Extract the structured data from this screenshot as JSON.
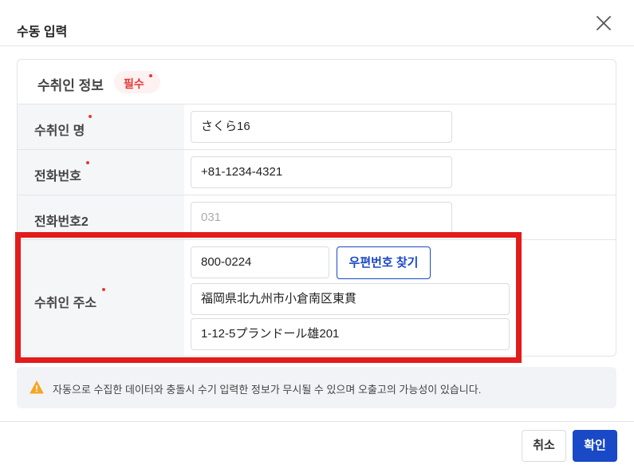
{
  "dialog": {
    "title": "수동 입력",
    "close_icon": "close-icon"
  },
  "section": {
    "title": "수취인 정보",
    "required_badge": "필수"
  },
  "form": {
    "recipient_name": {
      "label": "수취인 명",
      "value": "さくら16",
      "required": true
    },
    "phone": {
      "label": "전화번호",
      "value": "+81-1234-4321",
      "required": true
    },
    "phone2": {
      "label": "전화번호2",
      "placeholder": "031",
      "required": false
    },
    "address": {
      "label": "수취인 주소",
      "required": true,
      "postcode": "800-0224",
      "postcode_button": "우편번호 찾기",
      "line1": "福岡県北九州市小倉南区東貫",
      "line2": "1-12-5プランドール雄201"
    }
  },
  "notice": {
    "icon": "warning-icon",
    "text": "자동으로 수집한 데이터와 충돌시 수기 입력한 정보가 무시될 수 있으며 오출고의 가능성이 있습니다."
  },
  "footer": {
    "cancel_label": "취소",
    "confirm_label": "확인"
  },
  "colors": {
    "primary": "#1a49c7",
    "required": "#e53935",
    "highlight": "#e31b1b"
  }
}
